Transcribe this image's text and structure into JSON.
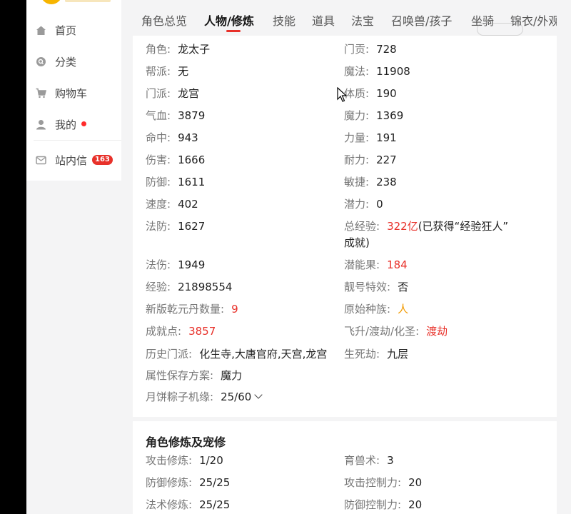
{
  "sidebar": {
    "items": [
      {
        "label": "首页",
        "icon": "home-icon"
      },
      {
        "label": "分类",
        "icon": "category-icon"
      },
      {
        "label": "购物车",
        "icon": "cart-icon"
      },
      {
        "label": "我的",
        "icon": "user-icon"
      },
      {
        "label": "站内信",
        "icon": "mail-icon",
        "badge": "163"
      }
    ]
  },
  "tabs": [
    "角色总览",
    "人物/修炼",
    "技能",
    "道具",
    "法宝",
    "召唤兽/孩子",
    "坐骑",
    "锦衣/外观"
  ],
  "active_tab": "人物/修炼",
  "attributes_left": [
    {
      "label": "角色:",
      "value": "龙太子"
    },
    {
      "label": "帮派:",
      "value": "无"
    },
    {
      "label": "门派:",
      "value": "龙宫"
    },
    {
      "label": "气血:",
      "value": "3879"
    },
    {
      "label": "命中:",
      "value": "943"
    },
    {
      "label": "伤害:",
      "value": "1666"
    },
    {
      "label": "防御:",
      "value": "1611"
    },
    {
      "label": "速度:",
      "value": "402"
    },
    {
      "label": "法防:",
      "value": "1627"
    },
    {
      "label": "法伤:",
      "value": "1949"
    },
    {
      "label": "经验:",
      "value": "21898554"
    },
    {
      "label": "新版乾元丹数量:",
      "value": "9"
    },
    {
      "label": "成就点:",
      "value": "3857"
    },
    {
      "label": "历史门派:",
      "value": "化生寺,大唐官府,天宫,龙宫"
    },
    {
      "label": "属性保存方案:",
      "value": "魔力"
    },
    {
      "label": "月饼粽子机缘:",
      "value": "25/60"
    }
  ],
  "attributes_right": [
    {
      "label": "门贡:",
      "value": "728"
    },
    {
      "label": "魔法:",
      "value": "11908"
    },
    {
      "label": "体质:",
      "value": "190"
    },
    {
      "label": "魔力:",
      "value": "1369"
    },
    {
      "label": "力量:",
      "value": "191"
    },
    {
      "label": "耐力:",
      "value": "227"
    },
    {
      "label": "敏捷:",
      "value": "238"
    },
    {
      "label": "潜力:",
      "value": "0"
    },
    {
      "label": "总经验:",
      "value": "322亿",
      "note_line1": "(已获得“经验狂人”",
      "note_line2": "成就)"
    },
    {
      "label": "潜能果:",
      "value": "184"
    },
    {
      "label": "靓号特效:",
      "value": "否"
    },
    {
      "label": "原始种族:",
      "value": "人"
    },
    {
      "label": "飞升/渡劫/化圣:",
      "value": "渡劫"
    },
    {
      "label": "生死劫:",
      "value": "九层"
    }
  ],
  "cultivation": {
    "title": "角色修炼及宠修",
    "left": [
      {
        "label": "攻击修炼:",
        "value": "1/20"
      },
      {
        "label": "防御修炼:",
        "value": "25/25"
      },
      {
        "label": "法术修炼:",
        "value": "25/25"
      }
    ],
    "right": [
      {
        "label": "育兽术:",
        "value": "3"
      },
      {
        "label": "攻击控制力:",
        "value": "20"
      },
      {
        "label": "防御控制力:",
        "value": "20"
      }
    ]
  },
  "colors": {
    "accent": "#e8312a",
    "highlight_orange": "#f29a00",
    "badge": "#e8312a"
  }
}
